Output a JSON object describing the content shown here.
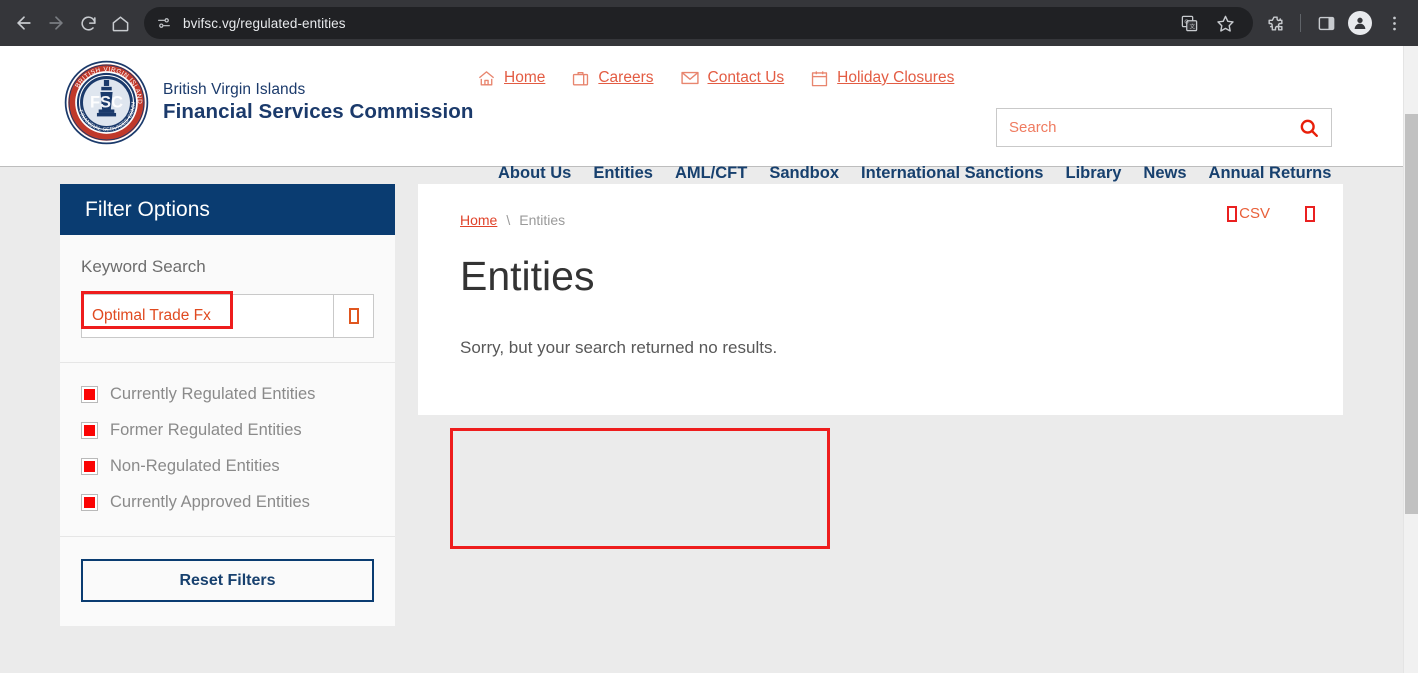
{
  "browser": {
    "url": "bvifsc.vg/regulated-entities",
    "back_label": "Back",
    "forward_label": "Forward",
    "reload_label": "Reload",
    "home_label": "Home",
    "site_info_label": "View site information",
    "translate_label": "Translate this page",
    "bookmark_label": "Bookmark this tab",
    "extensions_label": "Extensions",
    "side_panel_label": "Side panel",
    "profile_label": "Profile",
    "menu_label": "Customize and control Chrome"
  },
  "header": {
    "logo": {
      "line1": "British Virgin Islands",
      "line2": "Financial Services Commission",
      "seal_center_text": "FSC",
      "seal_top_text": "BRITISH VIRGIN ISLANDS",
      "seal_bottom_text": "FINANCIAL SERVICES COMMISSION"
    },
    "utility_nav": [
      {
        "label": "Home",
        "icon": "home-icon"
      },
      {
        "label": "Careers",
        "icon": "briefcase-icon"
      },
      {
        "label": "Contact Us",
        "icon": "envelope-icon"
      },
      {
        "label": "Holiday Closures",
        "icon": "calendar-icon"
      }
    ],
    "search": {
      "placeholder": "Search",
      "value": "",
      "button_icon": "search-icon"
    },
    "main_nav": [
      "About Us",
      "Entities",
      "AML/CFT",
      "Sandbox",
      "International Sanctions",
      "Library",
      "News",
      "Annual Returns"
    ]
  },
  "sidebar": {
    "title": "Filter Options",
    "keyword": {
      "label": "Keyword Search",
      "value": "Optimal Trade Fx",
      "placeholder": "",
      "button_icon": "missing-glyph-icon"
    },
    "filters": [
      {
        "label": "Currently Regulated Entities",
        "checked": true
      },
      {
        "label": "Former Regulated Entities",
        "checked": true
      },
      {
        "label": "Non-Regulated Entities",
        "checked": true
      },
      {
        "label": "Currently Approved Entities",
        "checked": true
      }
    ],
    "reset_label": "Reset Filters"
  },
  "content": {
    "breadcrumb": {
      "home": "Home",
      "separator": "\\",
      "current": "Entities"
    },
    "export": {
      "csv_label": "CSV",
      "csv_icon": "missing-glyph-icon",
      "print_icon": "missing-glyph-icon"
    },
    "title": "Entities",
    "message": "Sorry, but your search returned no results."
  },
  "colors": {
    "brand_navy": "#0a3c71",
    "accent_red": "#e35c43",
    "checkbox_red": "#fb0404",
    "annotation_red": "#ee1d1d",
    "page_bg": "#ebebeb"
  }
}
